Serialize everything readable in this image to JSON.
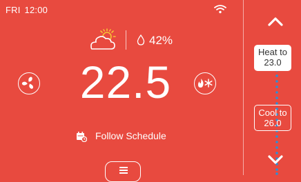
{
  "status": {
    "day": "FRI",
    "time": "12:00"
  },
  "weather": {
    "condition_icon": "sun-behind-cloud-icon",
    "humidity": "42%"
  },
  "temperature": {
    "current": "22.5"
  },
  "schedule": {
    "label": "Follow Schedule"
  },
  "setpoints": {
    "heat": {
      "label": "Heat to",
      "value": "23.0"
    },
    "cool": {
      "label": "Cool to",
      "value": "26.0"
    }
  },
  "colors": {
    "background": "#e84a3f",
    "foreground": "#ffffff",
    "dots": "#2b8fd6"
  }
}
